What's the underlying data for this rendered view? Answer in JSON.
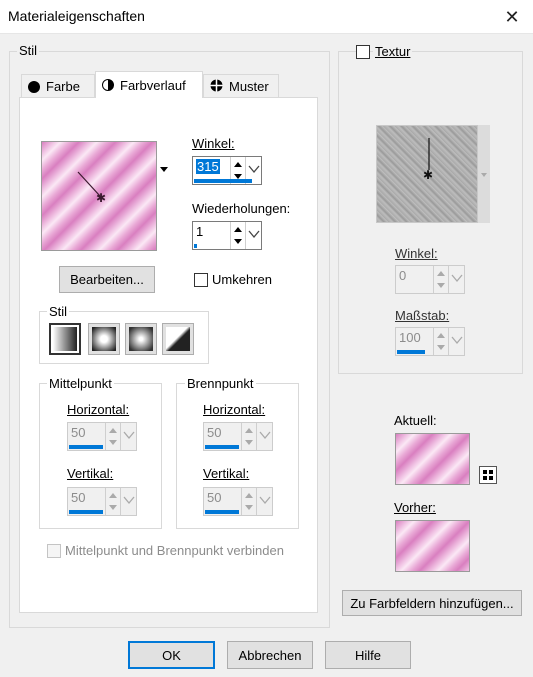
{
  "window": {
    "title": "Materialeigenschaften"
  },
  "stil_group": {
    "legend": "Stil"
  },
  "tabs": [
    {
      "label": "Farbe",
      "icon": "circle-icon"
    },
    {
      "label": "Farbverlauf",
      "icon": "half-circle-icon",
      "active": true
    },
    {
      "label": "Muster",
      "icon": "pattern-icon"
    }
  ],
  "gradient": {
    "angle_label": "Winkel:",
    "angle_value": "315",
    "angle_fraction": 0.875,
    "repeat_label": "Wiederholungen:",
    "repeat_value": "1",
    "repeat_fraction": 0.01,
    "edit_button": "Bearbeiten...",
    "invert_label": "Umkehren",
    "stil_label": "Stil",
    "center_group": "Mittelpunkt",
    "focal_group": "Brennpunkt",
    "horizontal_label": "Horizontal:",
    "vertical_label": "Vertikal:",
    "center_h": "50",
    "center_v": "50",
    "focal_h": "50",
    "focal_v": "50",
    "link_label": "Mittelpunkt und Brennpunkt verbinden"
  },
  "texture": {
    "label": "Textur",
    "angle_label": "Winkel:",
    "angle_value": "0",
    "scale_label": "Maßstab:",
    "scale_value": "100"
  },
  "current_label": "Aktuell:",
  "previous_label": "Vorher:",
  "add_swatch_button": "Zu Farbfeldern hinzufügen...",
  "buttons": {
    "ok": "OK",
    "cancel": "Abbrechen",
    "help": "Hilfe"
  },
  "colors": {
    "accent": "#0078d7",
    "gradient_pink": "#d97fc0",
    "gradient_light": "#fbe8f5"
  }
}
